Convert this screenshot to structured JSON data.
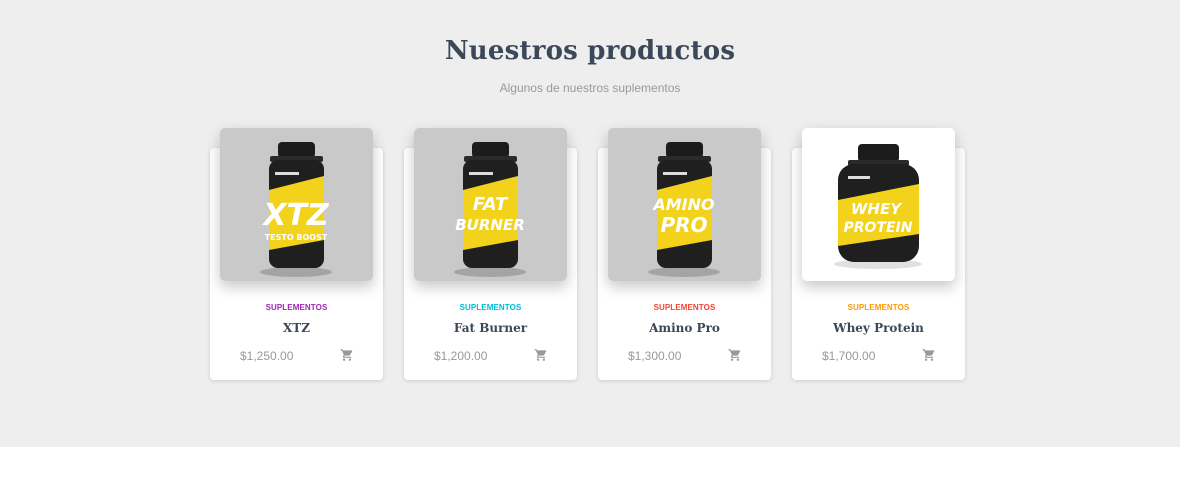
{
  "section": {
    "title": "Nuestros productos",
    "subtitle": "Algunos de nuestros suplementos"
  },
  "products": [
    {
      "category": "SUPLEMENTOS",
      "category_color": "#9c27b0",
      "name": "XTZ",
      "price": "$1,250.00",
      "label_lines": [
        "XTZ"
      ],
      "label_small": "TESTO BOOST",
      "image_bg": "#c9c9c9",
      "cart_icon": "cart-icon"
    },
    {
      "category": "SUPLEMENTOS",
      "category_color": "#00bcd4",
      "name": "Fat Burner",
      "price": "$1,200.00",
      "label_lines": [
        "FAT",
        "BURNER"
      ],
      "label_small": "",
      "image_bg": "#c9c9c9",
      "cart_icon": "cart-icon"
    },
    {
      "category": "SUPLEMENTOS",
      "category_color": "#f44336",
      "name": "Amino Pro",
      "price": "$1,300.00",
      "label_lines": [
        "AMINO",
        "PRO"
      ],
      "label_small": "",
      "image_bg": "#c9c9c9",
      "cart_icon": "cart-icon"
    },
    {
      "category": "SUPLEMENTOS",
      "category_color": "#ff9800",
      "name": "Whey Protein",
      "price": "$1,700.00",
      "label_lines": [
        "WHEY",
        "PROTEIN"
      ],
      "label_small": "",
      "image_bg": "#ffffff",
      "cart_icon": "cart-icon"
    }
  ]
}
